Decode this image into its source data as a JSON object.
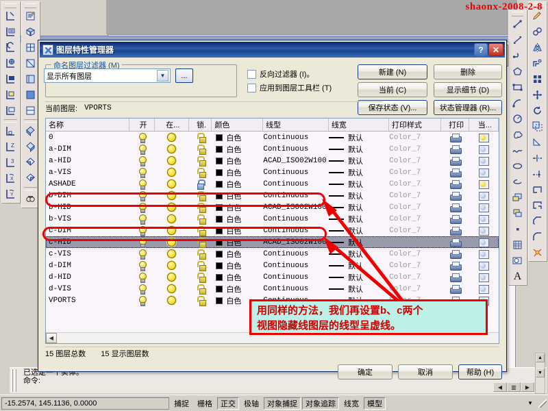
{
  "watermark": "shaonx-2008-2-8",
  "dialog": {
    "title": "图层特性管理器",
    "titlebar_buttons": {
      "help": "?",
      "close": "✕"
    },
    "filter_group_label": "命名图层过滤器 (M)",
    "filter_value": "显示所有图层",
    "ellipsis_label": "...",
    "checkboxes": [
      {
        "label": "反向过滤器 (I)。",
        "checked": false
      },
      {
        "label": "应用到图层工具栏 (T)",
        "checked": false
      }
    ],
    "buttons": {
      "new": "新建 (N)",
      "delete": "删除",
      "current": "当前 (C)",
      "show_details": "显示细节 (D)",
      "save_state": "保存状态 (V)...",
      "state_manager": "状态管理器 (R)..."
    },
    "current_layer_label": "当前图层:",
    "current_layer_value": "VPORTS",
    "columns": [
      "名称",
      "开",
      "在...",
      "锁.",
      "颜色",
      "线型",
      "线宽",
      "打印样式",
      "打印",
      "当..."
    ],
    "layers": [
      {
        "name": "0",
        "on": true,
        "thaw": true,
        "locked": false,
        "color": "白色",
        "linetype": "Continuous",
        "lineweight": "默认",
        "plotstyle": "Color_7",
        "plot": true,
        "vp_thaw": true
      },
      {
        "name": "a-DIM",
        "on": true,
        "thaw": true,
        "locked": false,
        "color": "白色",
        "linetype": "Continuous",
        "lineweight": "默认",
        "plotstyle": "Color_7",
        "plot": true,
        "vp_thaw": false
      },
      {
        "name": "a-HID",
        "on": true,
        "thaw": true,
        "locked": false,
        "color": "白色",
        "linetype": "ACAD_ISO02W100",
        "lineweight": "默认",
        "plotstyle": "Color_7",
        "plot": true,
        "vp_thaw": false
      },
      {
        "name": "a-VIS",
        "on": true,
        "thaw": true,
        "locked": false,
        "color": "白色",
        "linetype": "Continuous",
        "lineweight": "默认",
        "plotstyle": "Color_7",
        "plot": true,
        "vp_thaw": false
      },
      {
        "name": "ASHADE",
        "on": true,
        "thaw": true,
        "locked": true,
        "color": "白色",
        "linetype": "Continuous",
        "lineweight": "默认",
        "plotstyle": "Color_7",
        "plot": true,
        "vp_thaw": true
      },
      {
        "name": "b-DIM",
        "on": true,
        "thaw": true,
        "locked": false,
        "color": "白色",
        "linetype": "Continuous",
        "lineweight": "默认",
        "plotstyle": "Color_7",
        "plot": true,
        "vp_thaw": false
      },
      {
        "name": "b-HID",
        "on": true,
        "thaw": true,
        "locked": false,
        "color": "白色",
        "linetype": "ACAD_ISO02W100",
        "lineweight": "默认",
        "plotstyle": "Color_7",
        "plot": true,
        "vp_thaw": false
      },
      {
        "name": "b-VIS",
        "on": true,
        "thaw": true,
        "locked": false,
        "color": "白色",
        "linetype": "Continuous",
        "lineweight": "默认",
        "plotstyle": "Color_7",
        "plot": true,
        "vp_thaw": false
      },
      {
        "name": "c-DIM",
        "on": true,
        "thaw": true,
        "locked": false,
        "color": "白色",
        "linetype": "Continuous",
        "lineweight": "默认",
        "plotstyle": "Color_7",
        "plot": true,
        "vp_thaw": false
      },
      {
        "name": "c-HID",
        "on": true,
        "thaw": true,
        "locked": false,
        "color": "白色",
        "linetype": "ACAD_ISO02W100",
        "lineweight": "默认",
        "plotstyle": "Color_7",
        "plot": true,
        "vp_thaw": false,
        "selected": true
      },
      {
        "name": "c-VIS",
        "on": true,
        "thaw": true,
        "locked": false,
        "color": "白色",
        "linetype": "Continuous",
        "lineweight": "默认",
        "plotstyle": "Color_7",
        "plot": true,
        "vp_thaw": false
      },
      {
        "name": "d-DIM",
        "on": true,
        "thaw": true,
        "locked": false,
        "color": "白色",
        "linetype": "Continuous",
        "lineweight": "默认",
        "plotstyle": "Color_7",
        "plot": true,
        "vp_thaw": false
      },
      {
        "name": "d-HID",
        "on": true,
        "thaw": true,
        "locked": false,
        "color": "白色",
        "linetype": "Continuous",
        "lineweight": "默认",
        "plotstyle": "Color_7",
        "plot": true,
        "vp_thaw": false
      },
      {
        "name": "d-VIS",
        "on": true,
        "thaw": true,
        "locked": false,
        "color": "白色",
        "linetype": "Continuous",
        "lineweight": "默认",
        "plotstyle": "Color_7",
        "plot": true,
        "vp_thaw": false
      },
      {
        "name": "VPORTS",
        "on": true,
        "thaw": true,
        "locked": false,
        "color": "白色",
        "linetype": "Continuous",
        "lineweight": "默认",
        "plotstyle": "Color_7",
        "plot": true,
        "vp_thaw": false
      }
    ],
    "counts": {
      "total": "15 图层总数",
      "shown": "15 显示图层数"
    },
    "footer_buttons": {
      "ok": "确定",
      "cancel": "取消",
      "help": "帮助 (H)"
    }
  },
  "annotation": {
    "line1": "用同样的方法，我们再设置b、c两个",
    "line2": "视图隐藏线图层的线型呈虚线。",
    "text_color": "#cc0000",
    "box_color": "#bdf0e6",
    "border_color": "#ee0000",
    "highlighted_rows": [
      "b-HID",
      "c-HID"
    ]
  },
  "command_window": {
    "line1": "已选定一个实体。",
    "line2": "命令:"
  },
  "statusbar": {
    "coordinates": "-15.2574,   145.1136,  0.0000",
    "toggles": [
      {
        "label": "捕捉",
        "pressed": false
      },
      {
        "label": "栅格",
        "pressed": false
      },
      {
        "label": "正交",
        "pressed": true
      },
      {
        "label": "极轴",
        "pressed": false
      },
      {
        "label": "对象捕捉",
        "pressed": true
      },
      {
        "label": "对象追踪",
        "pressed": true
      },
      {
        "label": "线宽",
        "pressed": false
      },
      {
        "label": "模型",
        "pressed": true
      }
    ]
  },
  "toolbars": {
    "ucs": [
      "ucs-icon",
      "ucs-named-icon",
      "ucs-previous-icon",
      "ucs-world-icon",
      "ucs-object-icon",
      "ucs-face-icon",
      "ucs-view-icon",
      "ucs-origin-icon",
      "ucs-zaxis-icon",
      "ucs-3point-icon",
      "ucs-xrotate-icon",
      "ucs-yrotate-icon"
    ],
    "view": [
      "named-views-icon",
      "top-view-icon",
      "bottom-view-icon",
      "left-view-icon",
      "right-view-icon",
      "front-view-icon",
      "back-view-icon",
      "swiso-view-icon",
      "seiso-view-icon",
      "neiso-view-icon",
      "nwiso-view-icon",
      "camera-icon"
    ],
    "draw": [
      "line-icon",
      "construction-line-icon",
      "polyline-icon",
      "polygon-icon",
      "rectangle-icon",
      "arc-icon",
      "circle-icon",
      "revcloud-icon",
      "spline-icon",
      "ellipse-icon",
      "ellipse-arc-icon",
      "insert-block-icon",
      "make-block-icon",
      "point-icon",
      "hatch-icon",
      "region-icon",
      "text-icon"
    ],
    "modify": [
      "erase-icon",
      "copy-icon",
      "mirror-icon",
      "offset-icon",
      "array-icon",
      "move-icon",
      "rotate-icon",
      "scale-icon",
      "stretch-icon",
      "trim-icon",
      "extend-icon",
      "break-at-point-icon",
      "break-icon",
      "chamfer-icon",
      "fillet-icon",
      "explode-icon"
    ]
  }
}
